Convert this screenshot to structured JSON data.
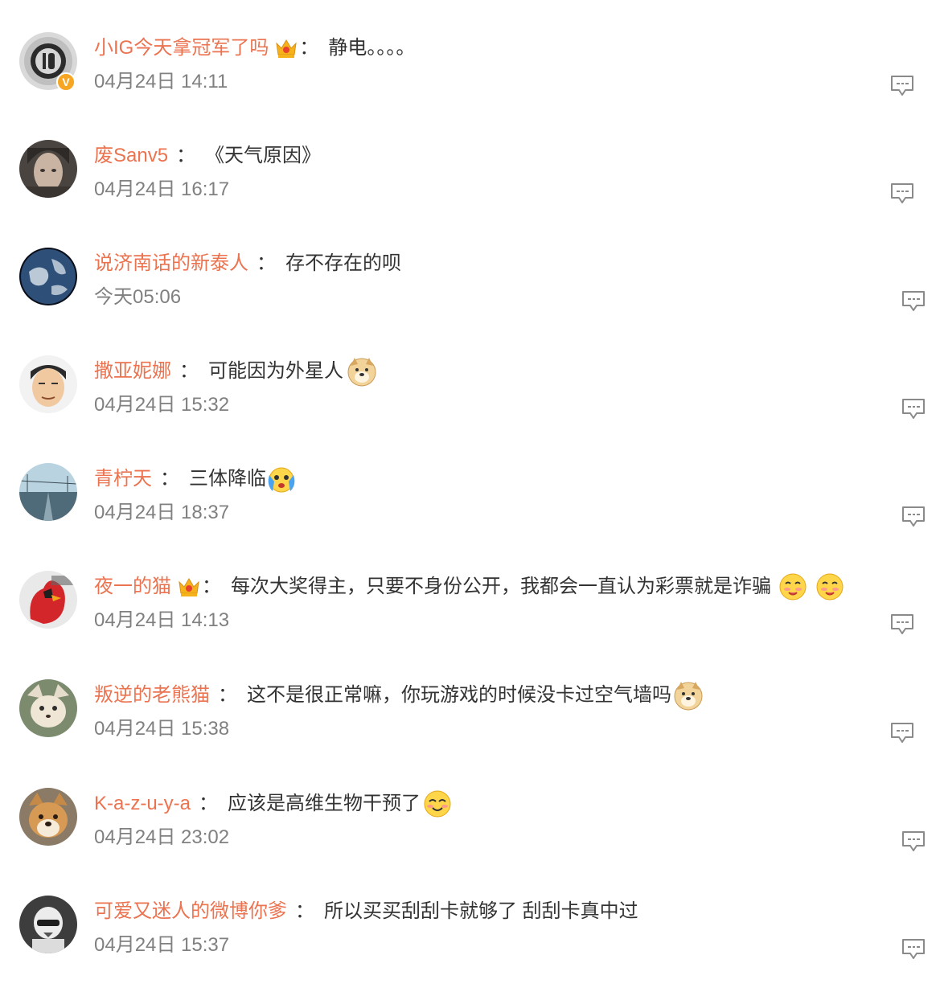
{
  "comments": [
    {
      "username": "小IG今天拿冠军了吗",
      "text": "静电。。。。",
      "time": "04月24日 14:11"
    },
    {
      "username": "废Sanv5",
      "text": "《天气原因》",
      "time": "04月24日 16:17"
    },
    {
      "username": "说济南话的新泰人",
      "text": "存不存在的呗",
      "time": "今天05:06"
    },
    {
      "username": "撒亚妮娜",
      "text": "可能因为外星人",
      "time": "04月24日 15:32"
    },
    {
      "username": "青柠天",
      "text": "三体降临",
      "time": "04月24日 18:37"
    },
    {
      "username": "夜一的猫",
      "text": "每次大奖得主，只要不身份公开，我都会一直认为彩票就是诈骗",
      "time": "04月24日 14:13"
    },
    {
      "username": "叛逆的老熊猫",
      "text": "这不是很正常嘛，你玩游戏的时候没卡过空气墙吗",
      "time": "04月24日 15:38"
    },
    {
      "username": "K-a-z-u-y-a",
      "text": "应该是高维生物干预了",
      "time": "04月24日 23:02"
    },
    {
      "username": "可爱又迷人的微博你爹",
      "text": "所以买买刮刮卡就够了 刮刮卡真中过",
      "time": "04月24日 15:37"
    }
  ],
  "separator": "：",
  "colors": {
    "username": "#eb7350",
    "text": "#333333",
    "time": "#808080",
    "icon": "#8a8a8a",
    "badge": "#f6a623"
  }
}
